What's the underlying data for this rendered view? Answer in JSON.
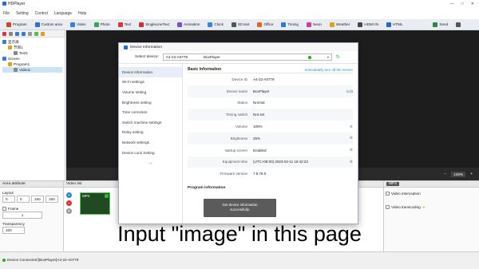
{
  "window": {
    "title": "HDPlayer",
    "min": "—",
    "max": "□",
    "close": "✕"
  },
  "menu": [
    "File",
    "Setting",
    "Control",
    "Language",
    "Help"
  ],
  "toolbar": [
    {
      "label": "Program",
      "icon": "program-icon",
      "color": "#c24a2a"
    },
    {
      "label": "Custom area",
      "icon": "custom-area-icon",
      "color": "#2f6fd4"
    },
    {
      "label": "Video",
      "icon": "video-icon",
      "color": "#3b7fd9"
    },
    {
      "label": "Photo",
      "icon": "photo-icon",
      "color": "#3aa45b"
    },
    {
      "label": "Text",
      "icon": "text-icon",
      "color": "#d23b3b"
    },
    {
      "label": "SingleLineText",
      "icon": "single-line-text-icon",
      "color": "#c33"
    },
    {
      "label": "Animation",
      "icon": "animation-icon",
      "color": "#7a4fc8"
    },
    {
      "label": "Clock",
      "icon": "clock-icon",
      "color": "#3b86d9"
    },
    {
      "label": "3D text",
      "icon": "3d-text-icon",
      "color": "#555"
    },
    {
      "label": "Office",
      "icon": "office-icon",
      "color": "#d96a26"
    },
    {
      "label": "Timing",
      "icon": "timing-icon",
      "color": "#2d7ad6"
    },
    {
      "label": "Neon",
      "icon": "neon-icon",
      "color": "#c93ca2"
    },
    {
      "label": "Weather",
      "icon": "weather-icon",
      "color": "#e0a21d"
    },
    {
      "label": "HDMI IN",
      "icon": "hdmi-icon",
      "color": "#444"
    },
    {
      "label": "HTML",
      "icon": "html-icon",
      "color": "#2a67c2"
    },
    {
      "label": "Send",
      "icon": "send-icon",
      "color": "#2a8a4a"
    },
    {
      "label": "",
      "icon": "more-icon",
      "color": "#555"
    }
  ],
  "tree": [
    {
      "label": "显示屏",
      "level": 0
    },
    {
      "label": "节目1",
      "level": 1
    },
    {
      "label": "Text1",
      "level": 2
    },
    {
      "label": "Screen",
      "level": 0
    },
    {
      "label": "Program1",
      "level": 1
    },
    {
      "label": "Video1",
      "level": 2
    }
  ],
  "zoom": "100%",
  "area_attribute": {
    "title": "Area attribute",
    "layout_label": "Layout",
    "layout_values": [
      "0",
      "0",
      "160",
      "160"
    ],
    "frame_label": "Frame",
    "frame_value": "1",
    "transparency_label": "Transparency",
    "transparency_value": "100"
  },
  "video_list": {
    "title": "Video list",
    "thumb_label": "MP4"
  },
  "video_props": {
    "badge": "MP4",
    "interception": "Video interception",
    "transcoding": "Video transcoding"
  },
  "dialog": {
    "title": "Device Information",
    "select_label": "Select device:",
    "device_id": "A4-22-A0779",
    "device_name": "BoxPlayer",
    "nav": [
      "Device information",
      "Wi-Fi settings",
      "Volume setting",
      "Brightness setting",
      "Time correction",
      "Switch machine settings",
      "Relay setting",
      "Network settings",
      "Device Lock Setting"
    ],
    "section_title": "Basic Information",
    "sync_link": "Immediately turn off the screen",
    "rows": [
      {
        "label": "Device ID",
        "value": "A4-22-A0779",
        "action": ""
      },
      {
        "label": "Device name",
        "value": "BoxPlayer",
        "action": "Edit"
      },
      {
        "label": "Status",
        "value": "Normal",
        "action": ""
      },
      {
        "label": "Timing switch",
        "value": "Not set",
        "action": ""
      },
      {
        "label": "Volume",
        "value": "100%",
        "action": "⚙"
      },
      {
        "label": "Brightness",
        "value": "25%",
        "action": "⚙"
      },
      {
        "label": "startup screen",
        "value": "Enabled",
        "action": "⚙"
      },
      {
        "label": "Equipment time",
        "value": "(UTC+08:00) 2023-03-11 16:42:23",
        "action": "⚙"
      },
      {
        "label": "Firmware version",
        "value": "7.8.76.0",
        "action": ""
      }
    ],
    "program_info": "Program information"
  },
  "toast": {
    "line1": "Get device information",
    "line2": "successfully."
  },
  "caption": "Input \"image\" in this page",
  "status": "Device Connected:[BoxPlayer]A4-22-A0779"
}
